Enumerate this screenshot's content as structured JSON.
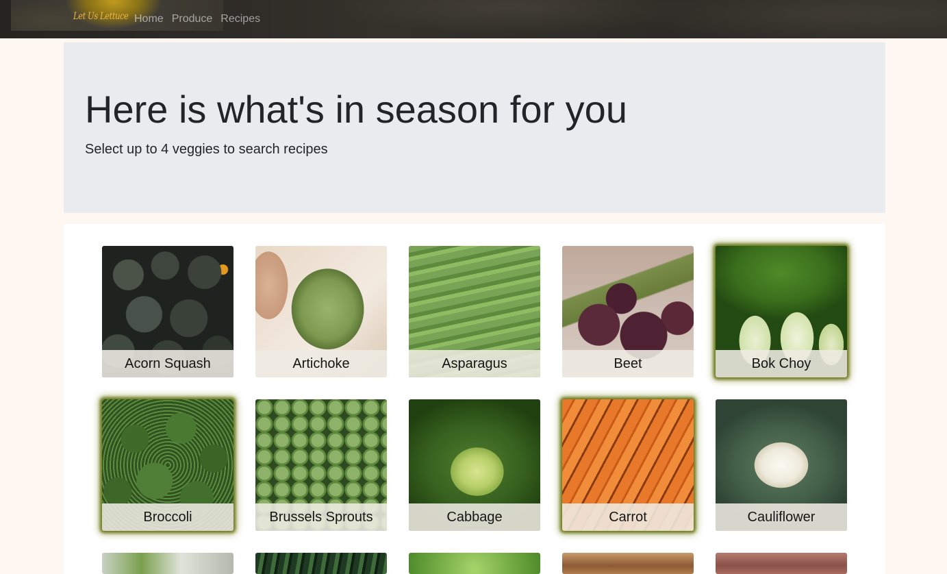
{
  "navbar": {
    "brand": "Let Us Lettuce",
    "links": [
      "Home",
      "Produce",
      "Recipes"
    ]
  },
  "jumbotron": {
    "title": "Here is what's in season for you",
    "subtitle": "Select up to 4 veggies to search recipes"
  },
  "produce": [
    {
      "name": "Acorn Squash",
      "selected": false
    },
    {
      "name": "Artichoke",
      "selected": false
    },
    {
      "name": "Asparagus",
      "selected": false
    },
    {
      "name": "Beet",
      "selected": false
    },
    {
      "name": "Bok Choy",
      "selected": true
    },
    {
      "name": "Broccoli",
      "selected": true
    },
    {
      "name": "Brussels Sprouts",
      "selected": false
    },
    {
      "name": "Cabbage",
      "selected": false
    },
    {
      "name": "Carrot",
      "selected": true
    },
    {
      "name": "Cauliflower",
      "selected": false
    }
  ],
  "colors": {
    "brand": "#f0b447",
    "selection_glow": "#6f7a20",
    "jumbotron_bg": "#e9ecef",
    "page_bg": "#fff8f2"
  }
}
